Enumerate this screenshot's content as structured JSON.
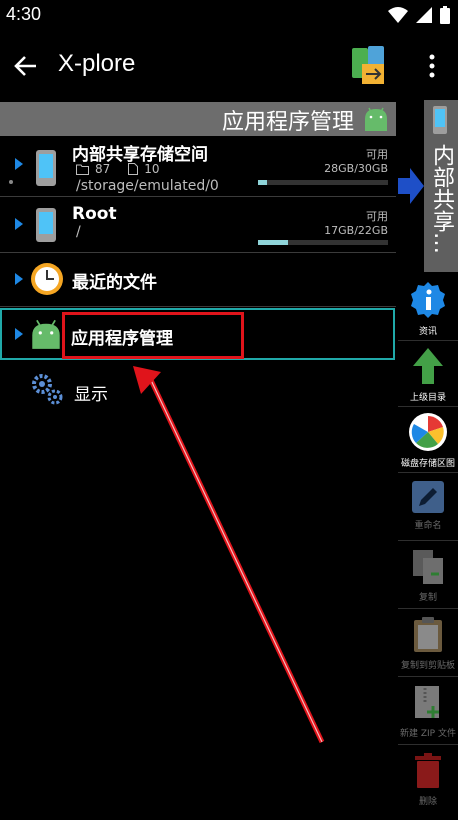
{
  "status_bar": {
    "time": "4:30"
  },
  "app_bar": {
    "title": "X-plore"
  },
  "pane_header": {
    "title": "应用程序管理"
  },
  "rows": {
    "internal": {
      "title": "内部共享存储空间",
      "folders": "87",
      "files": "10",
      "path": "/storage/emulated/0",
      "avail_label": "可用",
      "size": "28GB/30GB",
      "used_fraction": 0.07
    },
    "root": {
      "title": "Root",
      "path": "/",
      "avail_label": "可用",
      "size": "17GB/22GB",
      "used_fraction": 0.23
    },
    "recent": {
      "title": "最近的文件"
    },
    "apps": {
      "title": "应用程序管理"
    },
    "display": {
      "title": "显示"
    }
  },
  "right_pane": {
    "title": "内部共享…"
  },
  "toolbar": {
    "info": "资讯",
    "parent": "上级目录",
    "disk_map": "磁盘存储区图",
    "rename": "重命名",
    "copy": "复制",
    "copy_clipboard": "复制到剪贴板",
    "new_zip": "新建 ZIP 文件",
    "delete": "删除"
  },
  "colors": {
    "accent_blue": "#1e88e5",
    "selection": "#20a9a9",
    "highlight_red": "#e0141b",
    "android_green": "#66bb6a"
  }
}
